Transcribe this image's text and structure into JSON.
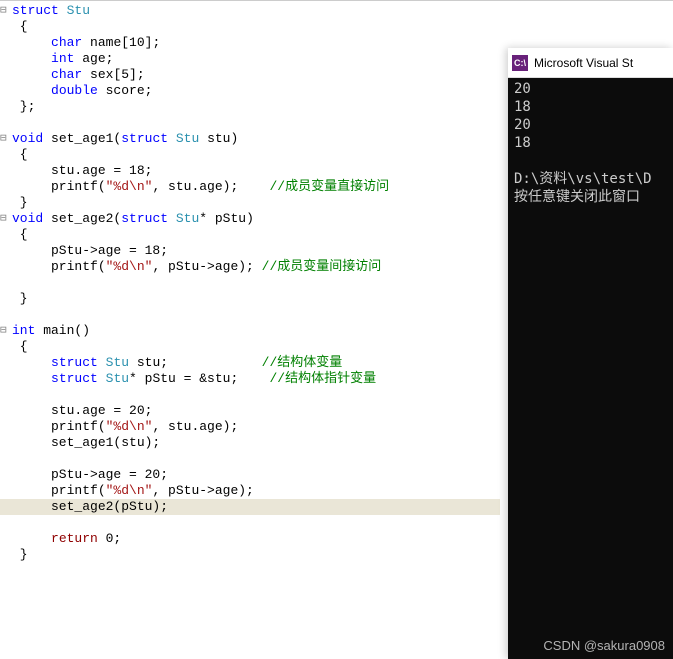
{
  "editor": {
    "lines": [
      {
        "gutter": "⊟",
        "tokens": [
          {
            "t": "struct",
            "c": "kw"
          },
          {
            "t": " "
          },
          {
            "t": "Stu",
            "c": "type"
          }
        ]
      },
      {
        "tokens": [
          {
            "t": " {"
          }
        ]
      },
      {
        "tokens": [
          {
            "t": "     "
          },
          {
            "t": "char",
            "c": "kw"
          },
          {
            "t": " name[10];"
          }
        ]
      },
      {
        "tokens": [
          {
            "t": "     "
          },
          {
            "t": "int",
            "c": "kw"
          },
          {
            "t": " age;"
          }
        ]
      },
      {
        "tokens": [
          {
            "t": "     "
          },
          {
            "t": "char",
            "c": "kw"
          },
          {
            "t": " sex[5];"
          }
        ]
      },
      {
        "tokens": [
          {
            "t": "     "
          },
          {
            "t": "double",
            "c": "kw"
          },
          {
            "t": " score;"
          }
        ]
      },
      {
        "tokens": [
          {
            "t": " };"
          }
        ]
      },
      {
        "tokens": [
          {
            "t": ""
          }
        ]
      },
      {
        "gutter": "⊟",
        "tokens": [
          {
            "t": "void",
            "c": "kw"
          },
          {
            "t": " set_age1("
          },
          {
            "t": "struct",
            "c": "kw"
          },
          {
            "t": " "
          },
          {
            "t": "Stu",
            "c": "type"
          },
          {
            "t": " stu)"
          }
        ]
      },
      {
        "tokens": [
          {
            "t": " {"
          }
        ]
      },
      {
        "tokens": [
          {
            "t": "     stu.age = 18;"
          }
        ]
      },
      {
        "tokens": [
          {
            "t": "     printf("
          },
          {
            "t": "\"%d\\n\"",
            "c": "str"
          },
          {
            "t": ", stu.age);    "
          },
          {
            "t": "//成员变量直接访问",
            "c": "cmt"
          }
        ]
      },
      {
        "tokens": [
          {
            "t": " }"
          }
        ]
      },
      {
        "gutter": "⊟",
        "tokens": [
          {
            "t": "void",
            "c": "kw"
          },
          {
            "t": " set_age2("
          },
          {
            "t": "struct",
            "c": "kw"
          },
          {
            "t": " "
          },
          {
            "t": "Stu",
            "c": "type"
          },
          {
            "t": "* pStu)"
          }
        ]
      },
      {
        "tokens": [
          {
            "t": " {"
          }
        ]
      },
      {
        "tokens": [
          {
            "t": "     pStu->age = 18;"
          }
        ]
      },
      {
        "tokens": [
          {
            "t": "     printf("
          },
          {
            "t": "\"%d\\n\"",
            "c": "str"
          },
          {
            "t": ", pStu->age); "
          },
          {
            "t": "//成员变量间接访问",
            "c": "cmt"
          }
        ]
      },
      {
        "tokens": [
          {
            "t": ""
          }
        ]
      },
      {
        "tokens": [
          {
            "t": " }"
          }
        ]
      },
      {
        "tokens": [
          {
            "t": ""
          }
        ]
      },
      {
        "gutter": "⊟",
        "tokens": [
          {
            "t": "int",
            "c": "kw"
          },
          {
            "t": " main()"
          }
        ]
      },
      {
        "tokens": [
          {
            "t": " {"
          }
        ]
      },
      {
        "tokens": [
          {
            "t": "     "
          },
          {
            "t": "struct",
            "c": "kw"
          },
          {
            "t": " "
          },
          {
            "t": "Stu",
            "c": "type"
          },
          {
            "t": " stu;            "
          },
          {
            "t": "//结构体变量",
            "c": "cmt"
          }
        ]
      },
      {
        "tokens": [
          {
            "t": "     "
          },
          {
            "t": "struct",
            "c": "kw"
          },
          {
            "t": " "
          },
          {
            "t": "Stu",
            "c": "type"
          },
          {
            "t": "* pStu = &stu;    "
          },
          {
            "t": "//结构体指针变量",
            "c": "cmt"
          }
        ]
      },
      {
        "tokens": [
          {
            "t": ""
          }
        ]
      },
      {
        "tokens": [
          {
            "t": "     stu.age = 20;"
          }
        ]
      },
      {
        "tokens": [
          {
            "t": "     printf("
          },
          {
            "t": "\"%d\\n\"",
            "c": "str"
          },
          {
            "t": ", stu.age);"
          }
        ]
      },
      {
        "tokens": [
          {
            "t": "     set_age1(stu);"
          }
        ]
      },
      {
        "tokens": [
          {
            "t": ""
          }
        ]
      },
      {
        "tokens": [
          {
            "t": "     pStu->age = 20;"
          }
        ]
      },
      {
        "tokens": [
          {
            "t": "     printf("
          },
          {
            "t": "\"%d\\n\"",
            "c": "str"
          },
          {
            "t": ", pStu->age);"
          }
        ]
      },
      {
        "hl": true,
        "tokens": [
          {
            "t": "     set_age2(pStu);"
          }
        ]
      },
      {
        "tokens": [
          {
            "t": ""
          }
        ]
      },
      {
        "tokens": [
          {
            "t": "     "
          },
          {
            "t": "return",
            "c": "kwred"
          },
          {
            "t": " 0;"
          }
        ]
      },
      {
        "tokens": [
          {
            "t": " }"
          }
        ]
      }
    ]
  },
  "console": {
    "title": "Microsoft Visual St",
    "icon_text": "C:\\",
    "output": [
      "20",
      "18",
      "20",
      "18",
      "",
      "D:\\资料\\vs\\test\\D",
      "按任意键关闭此窗口"
    ]
  },
  "watermark": "CSDN @sakura0908"
}
